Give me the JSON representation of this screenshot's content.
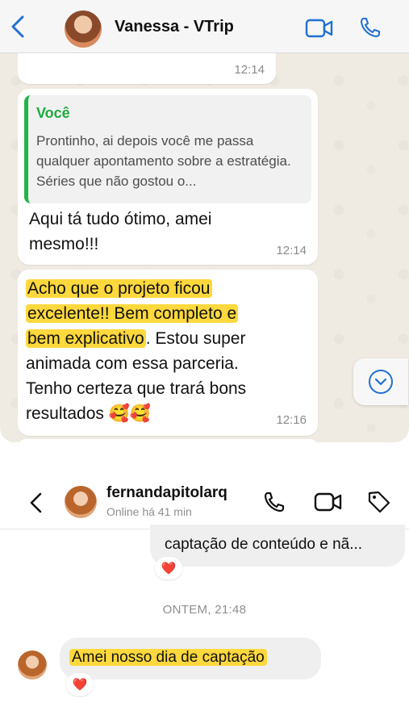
{
  "whatsapp": {
    "contact_name": "Vanessa - VTrip",
    "messages": [
      {
        "id": "m1",
        "time": "12:14"
      },
      {
        "id": "m2",
        "quote_author": "Você",
        "quote_text": "Prontinho, ai depois você me passa qualquer apontamento sobre a estratégia. Séries que não gostou o...",
        "text": "Aqui tá tudo ótimo, amei mesmo!!!",
        "time": "12:14"
      },
      {
        "id": "m3",
        "highlight_line1": "Acho que o projeto ficou",
        "highlight_line2": "excelente!! Bem completo e",
        "highlight_line3": "bem explicativo",
        "rest_line3": ". Estou super",
        "line4": "animada com essa parceria.",
        "line5": "Tenho certeza que trará bons",
        "line6": "resultados 🥰🥰",
        "time": "12:16"
      }
    ],
    "colors": {
      "quote_bar": "#25b34a",
      "highlight": "#ffd83d",
      "accent": "#1f6fd1"
    }
  },
  "instagram": {
    "username": "fernandapitolarq",
    "status": "Online há 41 min",
    "sent_message_preview": "captação de conteúdo e nã...",
    "date_separator": "ONTEM, 21:48",
    "received_message": "Amei nosso dia de captação",
    "reaction": "❤️"
  }
}
